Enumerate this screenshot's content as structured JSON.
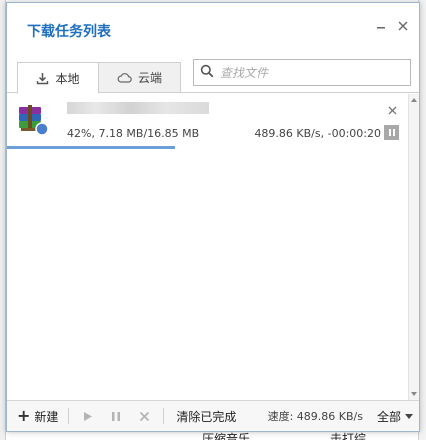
{
  "window": {
    "title": "下载任务列表",
    "minimize_icon": "minimize-icon",
    "close_icon": "close-icon"
  },
  "tabs": [
    {
      "label": "本地",
      "icon": "download-icon",
      "active": true
    },
    {
      "label": "云端",
      "icon": "cloud-icon",
      "active": false
    }
  ],
  "search": {
    "placeholder": "查找文件",
    "value": "",
    "icon": "search-icon"
  },
  "downloads": [
    {
      "name": "",
      "icon": "winrar-archive-icon",
      "progress_text": "42%, 7.18 MB/16.85 MB",
      "speed_text": "489.86 KB/s, -00:00:20",
      "progress": 0.42
    }
  ],
  "footer": {
    "new_label": "新建",
    "start_icon": "play-icon",
    "pause_icon": "pause-icon",
    "delete_icon": "delete-x-icon",
    "clear_label": "清除已完成",
    "speed_text": "速度: 489.86 KB/s",
    "filter_label": "全部"
  },
  "background": {
    "bottom_text_1": "压缩音乐",
    "bottom_text_2": "击打综"
  },
  "colors": {
    "title": "#1f6fc0",
    "progress": "#6a9fd8",
    "border": "#9fb6cf"
  }
}
